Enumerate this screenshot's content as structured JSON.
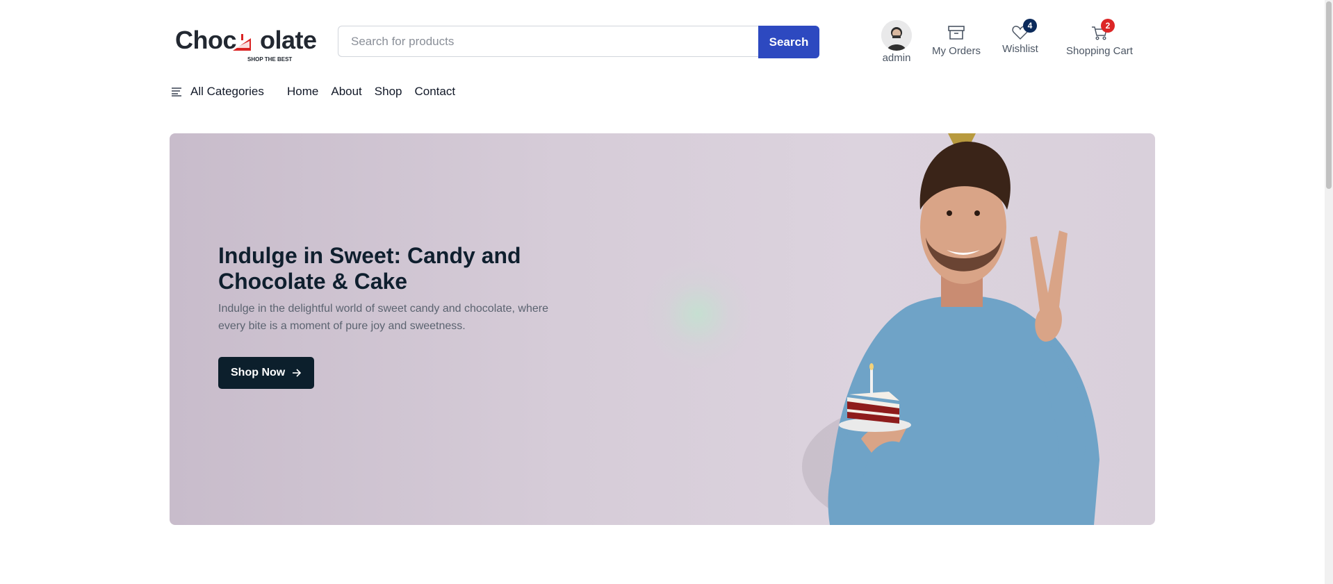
{
  "brand": {
    "logo_text_left": "Choc",
    "logo_text_right": "olate",
    "tagline": "SHOP THE BEST"
  },
  "search": {
    "placeholder": "Search for products",
    "button_label": "Search"
  },
  "user_tools": {
    "account_label": "admin",
    "orders_label": "My Orders",
    "wishlist_label": "Wishlist",
    "wishlist_count": "4",
    "cart_label": "Shopping Cart",
    "cart_count": "2"
  },
  "nav": {
    "categories_label": "All Categories",
    "links": [
      "Home",
      "About",
      "Shop",
      "Contact"
    ]
  },
  "hero": {
    "title": "Indulge in Sweet: Candy and Chocolate & Cake",
    "subtitle": "Indulge in the delightful world of sweet candy and chocolate, where every bite is a moment of pure joy and sweetness.",
    "button_label": "Shop Now"
  },
  "colors": {
    "primary": "#2d49c0",
    "dark": "#0c1f2c",
    "wishlist_badge": "#0b2a5b",
    "cart_badge": "#dc2626",
    "hero_bg": "#d6ccd8"
  }
}
